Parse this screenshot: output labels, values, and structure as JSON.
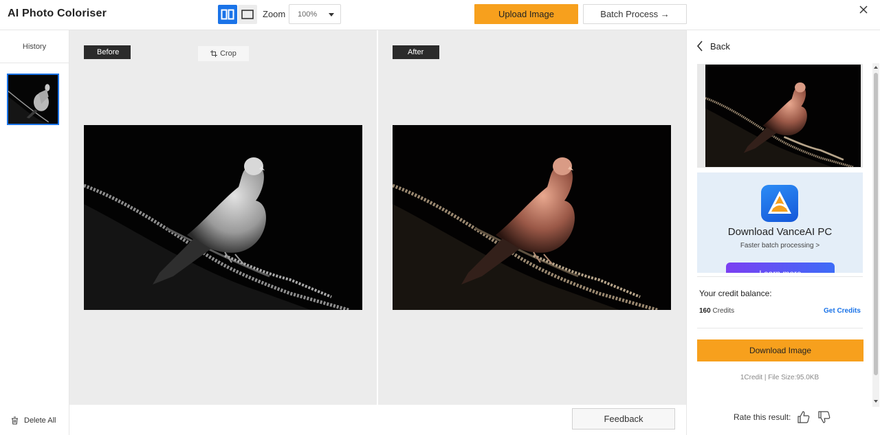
{
  "header": {
    "title": "AI Photo Coloriser",
    "zoom_label": "Zoom",
    "zoom_value": "100%",
    "upload_label": "Upload Image",
    "batch_label": "Batch Process →"
  },
  "history": {
    "title": "History",
    "delete_all": "Delete All"
  },
  "canvas": {
    "before_label": "Before",
    "after_label": "After",
    "crop_label": "Crop"
  },
  "footer": {
    "feedback_label": "Feedback"
  },
  "right_panel": {
    "back_label": "Back",
    "promo": {
      "title": "Download VanceAI PC",
      "subtitle": "Faster batch processing >",
      "button": "Learn more"
    },
    "credit_label": "Your credit balance:",
    "credit_amount": "160",
    "credit_unit": "Credits",
    "get_credits": "Get Credits",
    "download_label": "Download Image",
    "file_info": "1Credit | File Size:95.0KB",
    "rate_label": "Rate this result:"
  },
  "colors": {
    "accent": "#f7a01d",
    "primary_blue": "#1a73e8",
    "canvas_bg": "#ececec"
  },
  "icons": [
    "split-view-icon",
    "single-view-icon",
    "dropdown-caret-icon",
    "close-icon",
    "crop-icon",
    "trash-icon",
    "chevron-left-icon",
    "thumbs-up-icon",
    "thumbs-down-icon"
  ]
}
